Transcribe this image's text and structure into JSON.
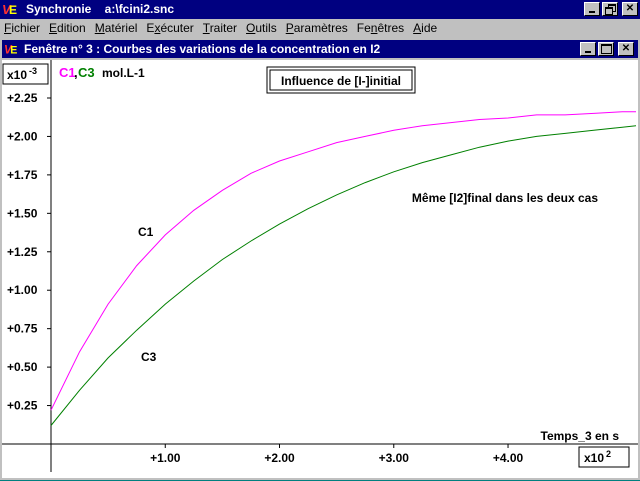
{
  "app": {
    "title": "Synchronie    a:\\fcini2.snc",
    "icon": "synchronie-logo-icon",
    "window_buttons": [
      "minimize",
      "restore",
      "close"
    ]
  },
  "menu": {
    "items": [
      {
        "pre": "",
        "u": "F",
        "post": "ichier"
      },
      {
        "pre": "",
        "u": "E",
        "post": "dition"
      },
      {
        "pre": "",
        "u": "M",
        "post": "atériel"
      },
      {
        "pre": "E",
        "u": "x",
        "post": "écuter"
      },
      {
        "pre": "",
        "u": "T",
        "post": "raiter"
      },
      {
        "pre": "",
        "u": "O",
        "post": "utils"
      },
      {
        "pre": "",
        "u": "P",
        "post": "aramètres"
      },
      {
        "pre": "Fe",
        "u": "n",
        "post": "êtres"
      },
      {
        "pre": "",
        "u": "A",
        "post": "ide"
      }
    ]
  },
  "window": {
    "title": "Fenêtre n° 3 : Courbes des variations de la concentration en I2"
  },
  "chart_data": {
    "type": "line",
    "title": "Influence de [I-]initial",
    "annotation": "Même [I2]final dans les deux cas",
    "xlabel": "Temps_3 en s",
    "x_multiplier": "x10 2",
    "ylabel": "mol.L-1",
    "y_multiplier": "x10 -3",
    "legend": [
      {
        "name": "C1",
        "color": "#ff00ff"
      },
      {
        "name": "C3",
        "color": "#008000"
      }
    ],
    "xlim": [
      0,
      5.12
    ],
    "ylim": [
      0,
      2.38
    ],
    "x_ticks": [
      1.0,
      2.0,
      3.0,
      4.0
    ],
    "x_tick_labels": [
      "+1.00",
      "+2.00",
      "+3.00",
      "+4.00"
    ],
    "y_ticks": [
      0.25,
      0.5,
      0.75,
      1.0,
      1.25,
      1.5,
      1.75,
      2.0,
      2.25
    ],
    "y_tick_labels": [
      "+0.25",
      "+0.50",
      "+0.75",
      "+1.00",
      "+1.25",
      "+1.50",
      "+1.75",
      "+2.00",
      "+2.25"
    ],
    "series": [
      {
        "name": "C1",
        "color": "#ff00ff",
        "curve_label": "C1",
        "x": [
          0,
          0.25,
          0.5,
          0.75,
          1.0,
          1.25,
          1.5,
          1.75,
          2.0,
          2.25,
          2.5,
          2.75,
          3.0,
          3.25,
          3.5,
          3.75,
          4.0,
          4.25,
          4.5,
          4.75,
          5.0,
          5.12
        ],
        "y": [
          0.22,
          0.6,
          0.91,
          1.16,
          1.36,
          1.52,
          1.65,
          1.76,
          1.84,
          1.9,
          1.96,
          2.0,
          2.04,
          2.07,
          2.09,
          2.11,
          2.12,
          2.14,
          2.14,
          2.15,
          2.16,
          2.16
        ]
      },
      {
        "name": "C3",
        "color": "#008000",
        "curve_label": "C3",
        "x": [
          0,
          0.25,
          0.5,
          0.75,
          1.0,
          1.25,
          1.5,
          1.75,
          2.0,
          2.25,
          2.5,
          2.75,
          3.0,
          3.25,
          3.5,
          3.75,
          4.0,
          4.25,
          4.5,
          4.75,
          5.0,
          5.12
        ],
        "y": [
          0.12,
          0.35,
          0.56,
          0.74,
          0.91,
          1.06,
          1.2,
          1.32,
          1.43,
          1.53,
          1.62,
          1.7,
          1.77,
          1.83,
          1.88,
          1.93,
          1.97,
          2.0,
          2.02,
          2.04,
          2.06,
          2.07
        ]
      }
    ],
    "grid": false
  }
}
